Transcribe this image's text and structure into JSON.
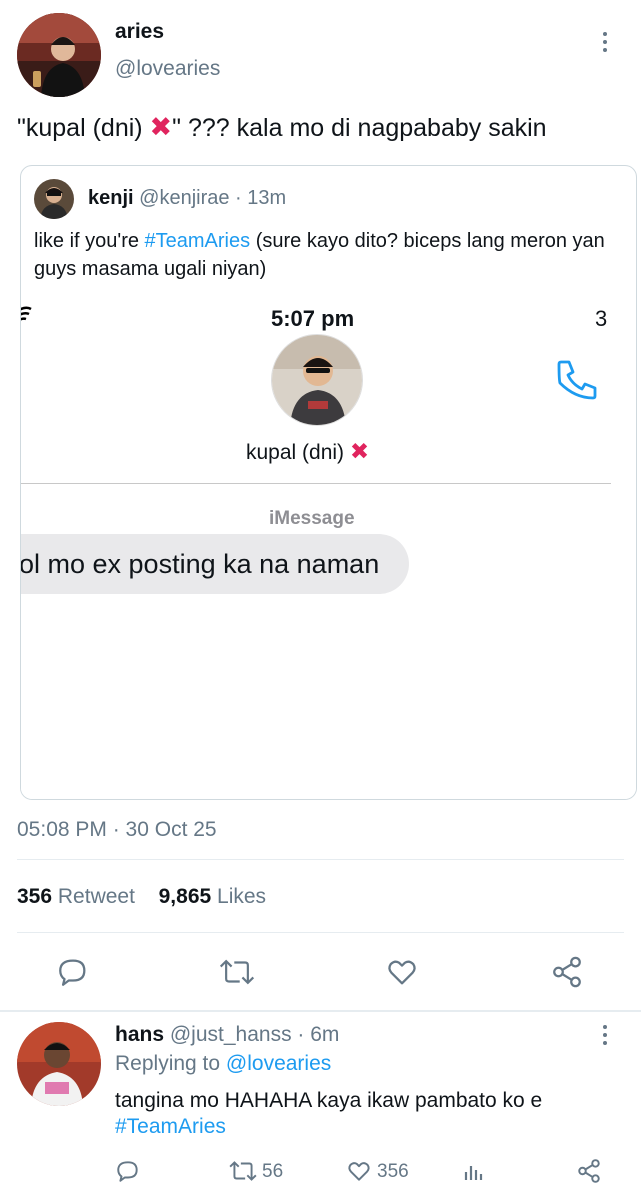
{
  "post": {
    "author": {
      "display_name": "aries",
      "handle": "@lovearies",
      "avatar": "user-photo-aries"
    },
    "text_part1": "\"kupal (dni) ",
    "text_emoji": "✖",
    "text_part2": "\" ??? kala mo di nagpababy sakin",
    "timestamp": "05:08 PM · 30 Oct 25",
    "stats": {
      "retweets_count": "356",
      "retweets_label": "Retweet",
      "likes_count": "9,865",
      "likes_label": "Likes"
    }
  },
  "quoted": {
    "author": {
      "display_name": "kenji",
      "handle": "@kenjirae",
      "time": "· 13m"
    },
    "text_part1": "like if you're ",
    "hashtag": "#TeamAries",
    "text_part2": " (sure kayo dito? biceps lang meron yan guys masama ugali niyan)",
    "screenshot": {
      "status_time": "5:07 pm",
      "status_right": "3",
      "contact_name": "kupal (dni) ",
      "contact_emoji": "✖",
      "service_label": "iMessage",
      "message_bubble": "ol mo ex posting ka na naman"
    }
  },
  "reply": {
    "author": {
      "display_name": "hans",
      "handle": "@just_hanss",
      "time": "· 6m"
    },
    "replying_prefix": "Replying to ",
    "replying_to": "@lovearies",
    "text": "tangina mo HAHAHA kaya ikaw pambato ko e",
    "hashtag": "#TeamAries",
    "actions": {
      "retweets": "56",
      "likes": "356"
    }
  },
  "colors": {
    "accent": "#1d9bf0",
    "muted": "#657786",
    "divider": "#e6ecf0",
    "x_red": "#e0245e",
    "bubble": "#e9e9eb"
  }
}
